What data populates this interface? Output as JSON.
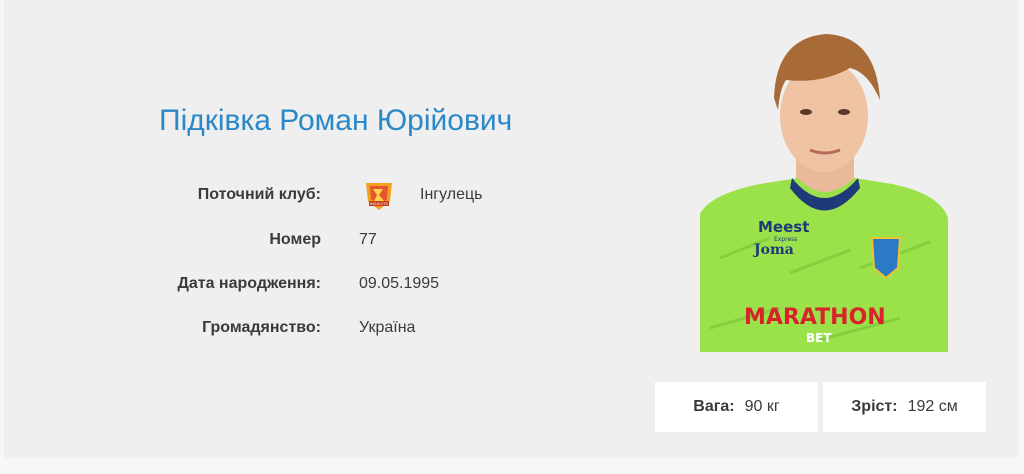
{
  "player": {
    "full_name": "Підківка Роман Юрійович",
    "photo_alt": "Фото гравця"
  },
  "info": {
    "club_label": "Поточний клуб:",
    "club_value": "Інгулець",
    "number_label": "Номер",
    "number_value": "77",
    "birth_label": "Дата народження:",
    "birth_value": "09.05.1995",
    "citizenship_label": "Громадянство:",
    "citizenship_value": "Україна"
  },
  "stats": {
    "weight_label": "Вага:",
    "weight_value": "90 кг",
    "height_label": "Зріст:",
    "height_value": "192 см"
  },
  "jersey": {
    "sponsor_top": "Meest",
    "sponsor_top_sub": "Express",
    "brand": "Joma",
    "sponsor_main": "MARATHON",
    "sponsor_sub": "BET"
  },
  "club_logo": {
    "text": "INGULETS"
  },
  "colors": {
    "accent": "#2a87c8",
    "jersey": "#9be24a",
    "background": "#efefef"
  }
}
